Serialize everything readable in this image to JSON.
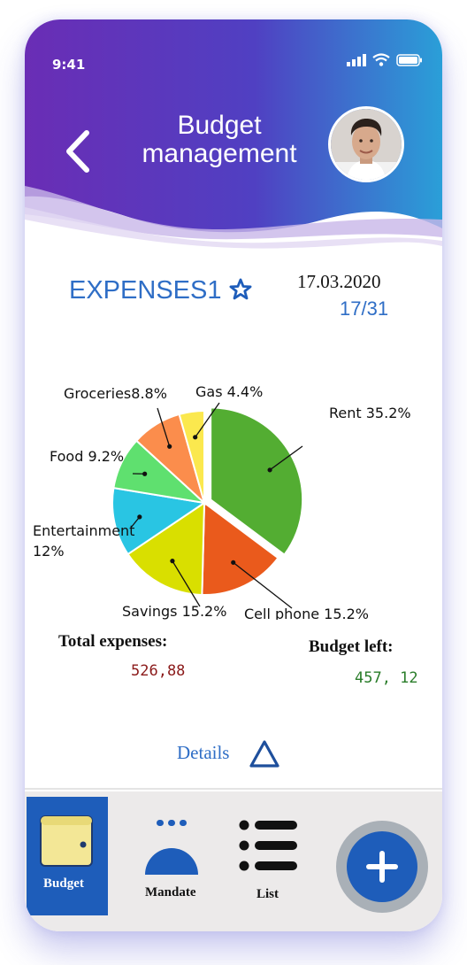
{
  "status_bar": {
    "time": "9:41"
  },
  "header": {
    "title_line1": "Budget",
    "title_line2": "management"
  },
  "expenses": {
    "title": "EXPENSES1",
    "date": "17.03.2020",
    "day": "17/31"
  },
  "chart_data": {
    "type": "pie",
    "slices": [
      {
        "label": "Rent 35.2%",
        "value": 35.2,
        "color": "#53ad32"
      },
      {
        "label": "Cell phone 15.2%",
        "value": 15.2,
        "color": "#ea5a1c"
      },
      {
        "label": "Savings 15.2%",
        "value": 15.2,
        "color": "#d9df00"
      },
      {
        "label": "Entertainment",
        "label2": "12%",
        "value": 12,
        "color": "#29c5e3"
      },
      {
        "label": "Food 9.2%",
        "value": 9.2,
        "color": "#5fe06f"
      },
      {
        "label": "Groceries8.8%",
        "value": 8.8,
        "color": "#fb8d4c"
      },
      {
        "label": "Gas 4.4%",
        "value": 4.4,
        "color": "#fbe84e"
      }
    ]
  },
  "totals": {
    "expenses_label": "Total expenses:",
    "expenses_value": "526,88",
    "budget_left_label": "Budget left:",
    "budget_left_value": "457, 12"
  },
  "details_label": "Details",
  "nav": {
    "budget": "Budget",
    "mandate": "Mandate",
    "list": "List"
  },
  "colors": {
    "accent": "#1e5dba",
    "header_purple": "#6a2db5",
    "header_blue": "#2a9fd8"
  }
}
